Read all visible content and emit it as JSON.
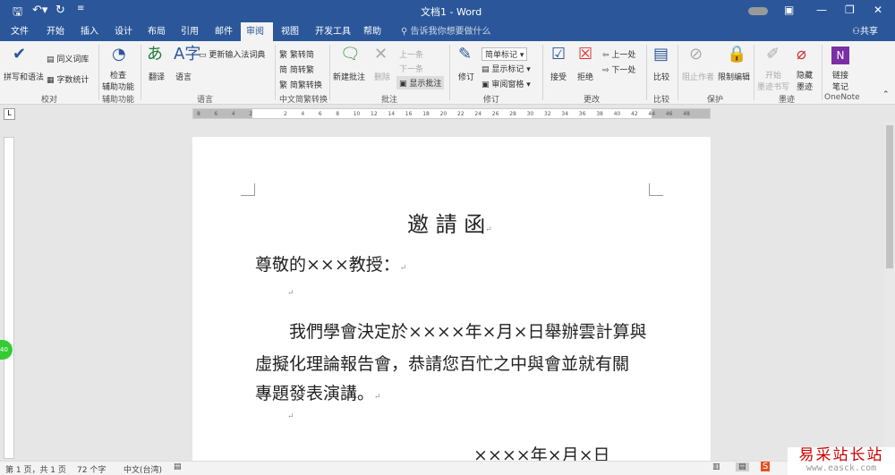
{
  "window": {
    "title": "文档1 - Word",
    "share": "共享"
  },
  "tabs": [
    "文件",
    "开始",
    "插入",
    "设计",
    "布局",
    "引用",
    "邮件",
    "审阅",
    "视图",
    "开发工具",
    "帮助"
  ],
  "active_tab": "审阅",
  "tell_me": "告诉我你想要做什么",
  "ribbon": {
    "spelling": "拼写和语法",
    "thesaurus": "同义词库",
    "wordcount": "字数统计",
    "grp_proof": "校对",
    "check_access": "检查\n辅助功能",
    "grp_access": "辅助功能",
    "translate": "翻译",
    "language": "语言",
    "update_ime": "更新输入法词典",
    "grp_lang": "语言",
    "trad": "繁转简",
    "simp": "简转繁",
    "convert": "简繁转换",
    "grp_cn": "中文简繁转换",
    "new_comment": "新建批注",
    "delete": "删除",
    "prev": "上一条",
    "next": "下一条",
    "show_comments": "显示批注",
    "grp_comments": "批注",
    "track": "修订",
    "simple_markup": "简单标记",
    "show_markup": "显示标记",
    "review_pane": "审阅窗格",
    "grp_track": "修订",
    "accept": "接受",
    "reject": "拒绝",
    "prev_change": "上一处",
    "next_change": "下一处",
    "grp_changes": "更改",
    "compare": "比较",
    "grp_compare": "比较",
    "block_authors": "阻止作者",
    "restrict": "限制编辑",
    "grp_protect": "保护",
    "start_ink": "开始\n墨迹书写",
    "hide_ink": "隐藏\n墨迹",
    "grp_ink": "墨迹",
    "link_notes": "链接\n笔记",
    "grp_onenote": "OneNote"
  },
  "ruler_ticks": [
    "8",
    "6",
    "4",
    "2",
    "",
    "2",
    "4",
    "6",
    "8",
    "10",
    "12",
    "14",
    "16",
    "18",
    "20",
    "22",
    "24",
    "26",
    "28",
    "30",
    "32",
    "34",
    "36",
    "38",
    "40",
    "42",
    "44",
    "46",
    "48"
  ],
  "document": {
    "title": "邀 請 函",
    "salutation": "尊敬的×××教授：",
    "body_lines": [
      "我們學會決定於××××年×月×日舉辦雲計算與",
      "虛擬化理論報告會，恭請您百忙之中與會並就有關",
      "專題發表演講。"
    ],
    "date": "××××年×月×日"
  },
  "status": {
    "page": "第 1 页，共 1 页",
    "words": "72 个字",
    "lang": "中文(台湾)"
  },
  "watermark": {
    "cn": "易采站长站",
    "url": "www.easck.com"
  },
  "colors": {
    "brand": "#2b579a"
  }
}
